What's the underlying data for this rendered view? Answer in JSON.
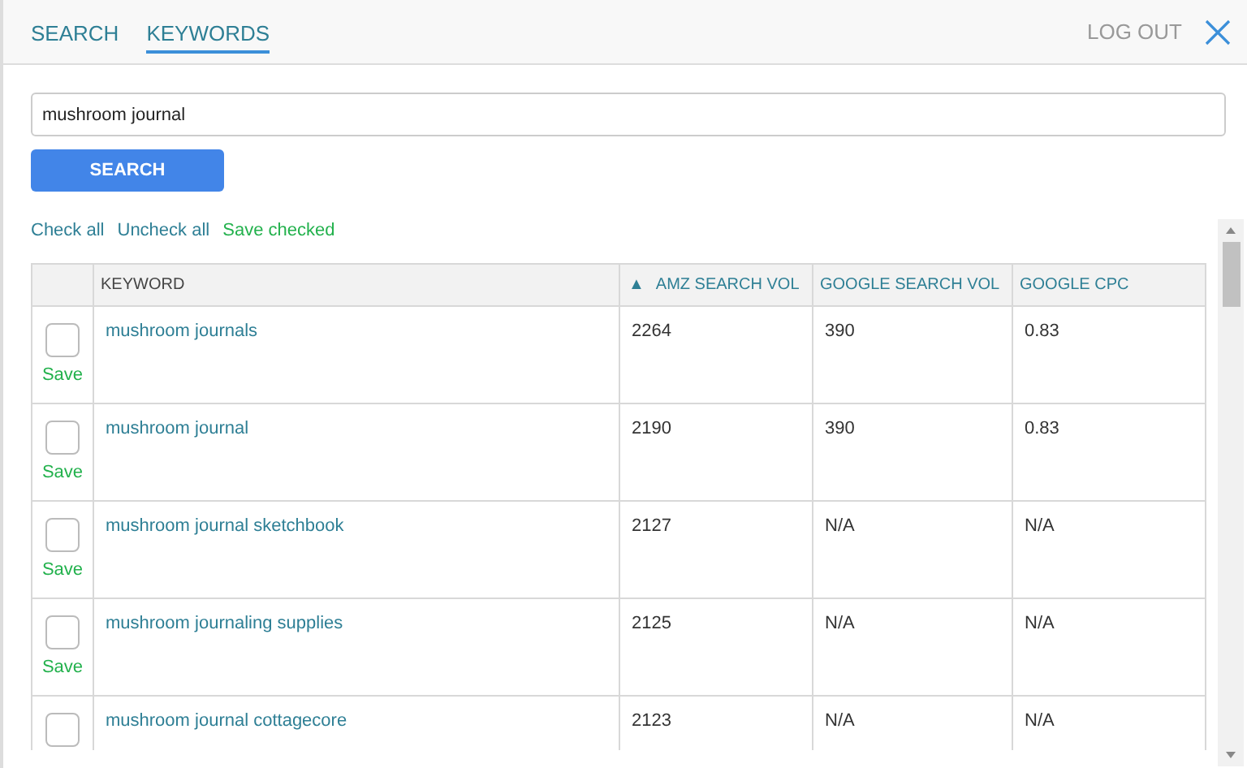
{
  "tabs": [
    {
      "label": "SEARCH",
      "selected": false
    },
    {
      "label": "KEYWORDS",
      "selected": true
    }
  ],
  "logout": "LOG OUT",
  "search": {
    "value": "mushroom journal",
    "button": "SEARCH"
  },
  "actions": [
    "Check all",
    "Uncheck all"
  ],
  "save_checked": "Save checked",
  "table": {
    "columns": [
      {
        "label": "KEYWORD",
        "sorted": false
      },
      {
        "label": "AMZ SEARCH VOL",
        "sorted": true,
        "sort_icon": "▲"
      },
      {
        "label": "GOOGLE SEARCH VOL",
        "sorted": false
      },
      {
        "label": "GOOGLE CPC",
        "sorted": false
      }
    ],
    "rows": [
      {
        "checked": false,
        "save": "Save",
        "keyword": "mushroom journals",
        "amz": "2264",
        "google_vol": "390",
        "cpc": "0.83"
      },
      {
        "checked": false,
        "save": "Save",
        "keyword": "mushroom journal",
        "amz": "2190",
        "google_vol": "390",
        "cpc": "0.83"
      },
      {
        "checked": false,
        "save": "Save",
        "keyword": "mushroom journal sketchbook",
        "amz": "2127",
        "google_vol": "N/A",
        "cpc": "N/A"
      },
      {
        "checked": false,
        "save": "Save",
        "keyword": "mushroom journaling supplies",
        "amz": "2125",
        "google_vol": "N/A",
        "cpc": "N/A"
      },
      {
        "checked": false,
        "keyword": "mushroom journal cottagecore",
        "amz": "2123",
        "google_vol": "N/A",
        "cpc": "N/A"
      }
    ]
  }
}
